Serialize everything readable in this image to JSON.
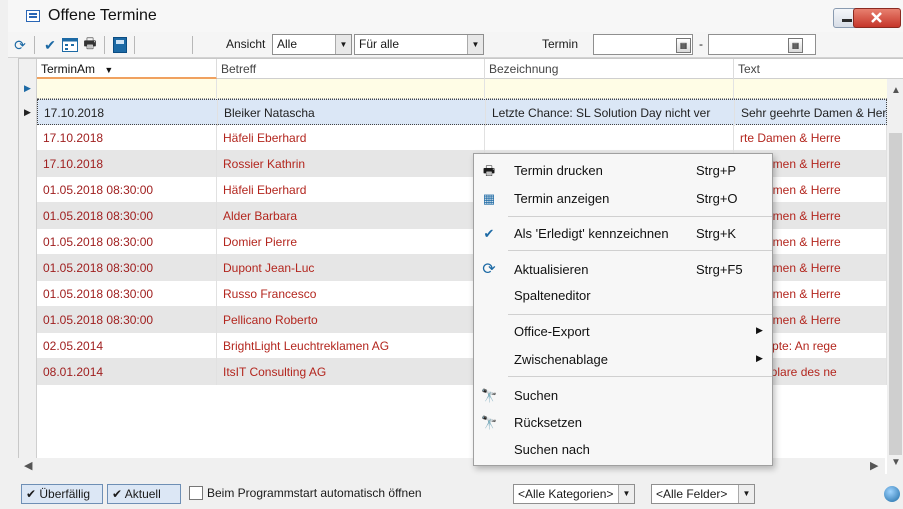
{
  "window": {
    "title": "Offene Termine"
  },
  "toolbar": {
    "ansicht_label": "Ansicht",
    "ansicht_value": "Alle",
    "fuer_value": "Für alle",
    "termin_label": "Termin",
    "date_from": "",
    "date_sep": "-",
    "date_to": ""
  },
  "columns": [
    "TerminAm",
    "Betreff",
    "Bezeichnung",
    "Text"
  ],
  "rows": [
    {
      "date": "17.10.2018",
      "betreff": "Bleiker Natascha",
      "bez": "Letzte Chance: SL Solution Day nicht ver",
      "text": "Sehr geehrte Damen & Herr"
    },
    {
      "date": "17.10.2018",
      "betreff": "Häfeli Eberhard",
      "bez": "",
      "text": "rte Damen & Herre"
    },
    {
      "date": "17.10.2018",
      "betreff": "Rossier Kathrin",
      "bez": "",
      "text": "rte Damen & Herre"
    },
    {
      "date": "01.05.2018 08:30:00",
      "betreff": "Häfeli Eberhard",
      "bez": "",
      "text": "rte Damen & Herre"
    },
    {
      "date": "01.05.2018 08:30:00",
      "betreff": "Alder Barbara",
      "bez": "",
      "text": "rte Damen & Herre"
    },
    {
      "date": "01.05.2018 08:30:00",
      "betreff": "Domier Pierre",
      "bez": "",
      "text": "rte Damen & Herre"
    },
    {
      "date": "01.05.2018 08:30:00",
      "betreff": "Dupont Jean-Luc",
      "bez": "",
      "text": "rte Damen & Herre"
    },
    {
      "date": "01.05.2018 08:30:00",
      "betreff": "Russo Francesco",
      "bez": "",
      "text": "rte Damen & Herre"
    },
    {
      "date": "01.05.2018 08:30:00",
      "betreff": "Pellicano Roberto",
      "bez": "",
      "text": "rte Damen & Herre"
    },
    {
      "date": "02.05.2014",
      "betreff": "BrightLight Leuchtreklamen AG",
      "bez": "S",
      "text": "konzepte: An rege"
    },
    {
      "date": "08.01.2014",
      "betreff": "ItsIT Consulting AG",
      "bez": "",
      "text": "Exemplare des ne"
    }
  ],
  "context_menu": [
    {
      "icon": "printer-icon",
      "glyph": "🖶",
      "label": "Termin drucken",
      "shortcut": "Strg+P"
    },
    {
      "icon": "calendar-view-icon",
      "glyph": "▦",
      "label": "Termin anzeigen",
      "shortcut": "Strg+O"
    },
    {
      "icon": "checkmark-icon",
      "glyph": "✔",
      "label": "Als 'Erledigt' kennzeichnen",
      "shortcut": "Strg+K"
    },
    {
      "icon": "refresh-icon",
      "glyph": "⟳",
      "label": "Aktualisieren",
      "shortcut": "Strg+F5"
    },
    {
      "icon": "",
      "glyph": "",
      "label": "Spalteneditor",
      "shortcut": ""
    },
    {
      "icon": "",
      "glyph": "",
      "label": "Office-Export",
      "shortcut": "",
      "submenu": "▶"
    },
    {
      "icon": "",
      "glyph": "",
      "label": "Zwischenablage",
      "shortcut": "",
      "submenu": "▶"
    },
    {
      "icon": "binoculars-icon",
      "glyph": "🔭",
      "label": "Suchen",
      "shortcut": ""
    },
    {
      "icon": "binoculars-reset-icon",
      "glyph": "🔭",
      "label": "Rücksetzen",
      "shortcut": ""
    },
    {
      "icon": "",
      "glyph": "",
      "label": "Suchen nach",
      "shortcut": ""
    }
  ],
  "statusbar": {
    "overdue_label": "Überfällig",
    "current_label": "Aktuell",
    "autostart_label": "Beim Programmstart automatisch öffnen",
    "categories_value": "<Alle Kategorien>",
    "fields_value": "<Alle Felder>"
  },
  "colors": {
    "accent": "#1d6aa5",
    "row_text": "#b3261e",
    "selection": "#dbe7f6"
  }
}
